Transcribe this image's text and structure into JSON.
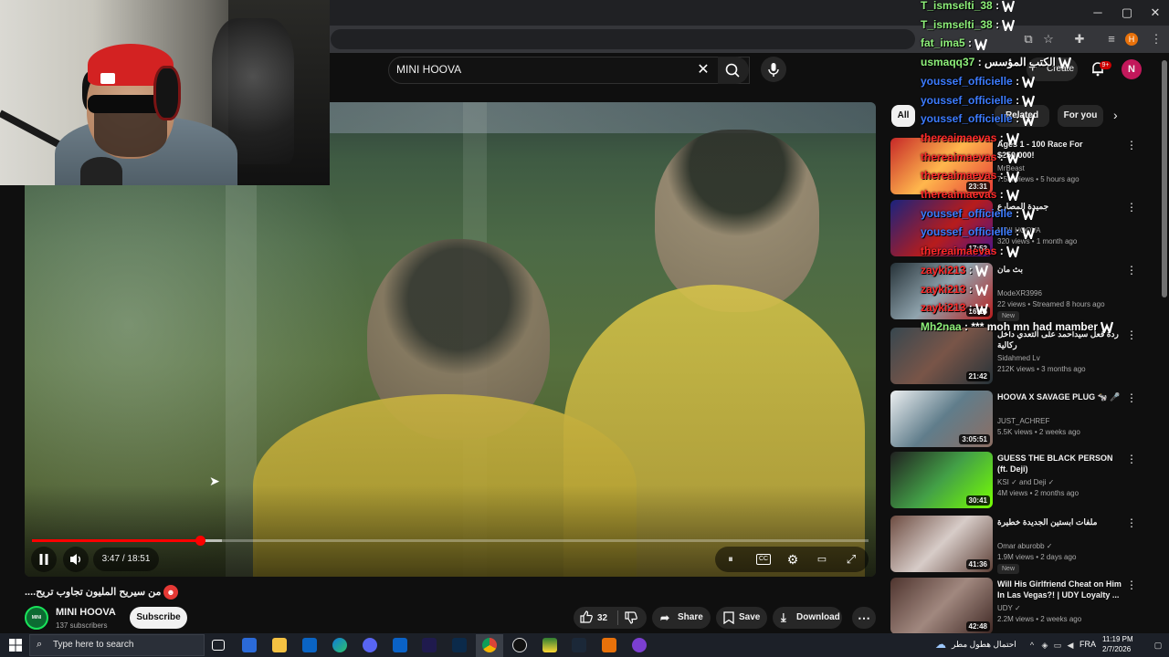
{
  "search": {
    "query": "MINI HOOVA"
  },
  "header": {
    "create_label": "Create",
    "notif_count": "9+",
    "avatar_letter": "N"
  },
  "player": {
    "time_display": "3:47 / 18:51",
    "played_fraction": 0.201,
    "buffered_fraction": 0.227
  },
  "video": {
    "title": "من سيريح المليون تجاوب تريح....",
    "channel": "MINI HOOVA",
    "channel_avatar_text": "MINI HOOVA",
    "subscribers": "137 subscribers",
    "subscribe_label": "Subscribe",
    "likes": "32",
    "share_label": "Share",
    "save_label": "Save",
    "download_label": "Download"
  },
  "chips": {
    "all": "All",
    "related": "Related",
    "for_you": "For you"
  },
  "recommendations": [
    {
      "title": "Ages 1 - 100 Race For $250,000!",
      "channel": "MrBeast",
      "meta": "7.5M views • 5 hours ago",
      "duration": "23:31",
      "badge": "",
      "thumb": "linear-gradient(135deg,#c62828,#ffb74d 50%,#e53935)"
    },
    {
      "title": "جميدة المصارع",
      "channel": "MINI HOOVA",
      "meta": "320 views • 1 month ago",
      "duration": "17:52",
      "badge": "",
      "thumb": "linear-gradient(135deg,#1a237e,#b71c1c 55%,#4a148c)"
    },
    {
      "title": "بث مان",
      "channel": "ModeXR3996",
      "meta": "22 views • Streamed 8 hours ago",
      "duration": "16:15",
      "badge": "New",
      "thumb": "linear-gradient(135deg,#263238,#90a4ae 50%,#b71c1c)"
    },
    {
      "title": "ردة فعل سيداحمد على التعدي داخل ركالية",
      "channel": "Sidahmed Lv",
      "meta": "212K views • 3 months ago",
      "duration": "21:42",
      "badge": "",
      "thumb": "linear-gradient(135deg,#37474f,#795548 50%,#263238)"
    },
    {
      "title": "HOOVA X SAVAGE PLUG 🐄 🎤",
      "channel": "JUST_ACHREF",
      "meta": "5.5K views • 2 weeks ago",
      "duration": "3:05:51",
      "badge": "",
      "thumb": "linear-gradient(135deg,#eceff1,#607d8b 50%,#8d6e63)"
    },
    {
      "title": "GUESS THE BLACK PERSON (ft. Deji)",
      "channel": "KSI ✓ and Deji ✓",
      "meta": "4M views • 2 months ago",
      "duration": "30:41",
      "badge": "",
      "thumb": "linear-gradient(135deg,#212121,#43a047 50%,#76ff03)"
    },
    {
      "title": "ملفات ابستين الجديدة خطيرة",
      "channel": "Omar aburobb ✓",
      "meta": "1.9M views • 2 days ago",
      "duration": "41:36",
      "badge": "New",
      "thumb": "linear-gradient(135deg,#6d4c41,#d7ccc8 50%,#5d4037)"
    },
    {
      "title": "Will His Girlfriend Cheat on Him In Las Vegas?! | UDY Loyalty ...",
      "channel": "UDY ✓",
      "meta": "2.2M views • 2 weeks ago",
      "duration": "42:48",
      "badge": "",
      "thumb": "linear-gradient(135deg,#4e342e,#a1887f 50%,#3e2723)"
    }
  ],
  "chat": [
    {
      "user": "T_ismselti_38",
      "msg": ":",
      "color": "#8ef07a"
    },
    {
      "user": "T_ismselti_38",
      "msg": ":",
      "color": "#8ef07a"
    },
    {
      "user": "fat_ima5",
      "msg": ":",
      "color": "#8ef07a"
    },
    {
      "user": "usmaqq37",
      "msg": ": الكتب المؤسس",
      "color": "#8ef07a"
    },
    {
      "user": "youssef_officielle",
      "msg": ":",
      "color": "#3d7cff"
    },
    {
      "user": "youssef_officielle",
      "msg": ":",
      "color": "#3d7cff"
    },
    {
      "user": "youssef_officielle",
      "msg": ":",
      "color": "#3d7cff"
    },
    {
      "user": "thereaimaevas",
      "msg": ":",
      "color": "#ff2a2a"
    },
    {
      "user": "thereaimaevas",
      "msg": ":",
      "color": "#ff2a2a"
    },
    {
      "user": "thereaimaevas",
      "msg": ":",
      "color": "#ff2a2a"
    },
    {
      "user": "thereaimaevas",
      "msg": ":",
      "color": "#ff2a2a"
    },
    {
      "user": "youssef_officielle",
      "msg": ":",
      "color": "#3d7cff"
    },
    {
      "user": "youssef_officielle",
      "msg": ":",
      "color": "#3d7cff"
    },
    {
      "user": "thereaimaevas",
      "msg": ":",
      "color": "#ff2a2a"
    },
    {
      "user": "zayki213",
      "msg": ":",
      "color": "#ff2a2a"
    },
    {
      "user": "zayki213",
      "msg": ":",
      "color": "#ff2a2a"
    },
    {
      "user": "zayki213",
      "msg": ":",
      "color": "#ff2a2a"
    },
    {
      "user": "Mh2naa",
      "msg": ": *** moh mn had mamber",
      "color": "#8ef07a"
    }
  ],
  "taskbar": {
    "search_placeholder": "Type here to search",
    "weather": "احتمال هطول مطر",
    "lang": "FRA",
    "time": "11:19 PM",
    "date": "2/7/2026"
  }
}
